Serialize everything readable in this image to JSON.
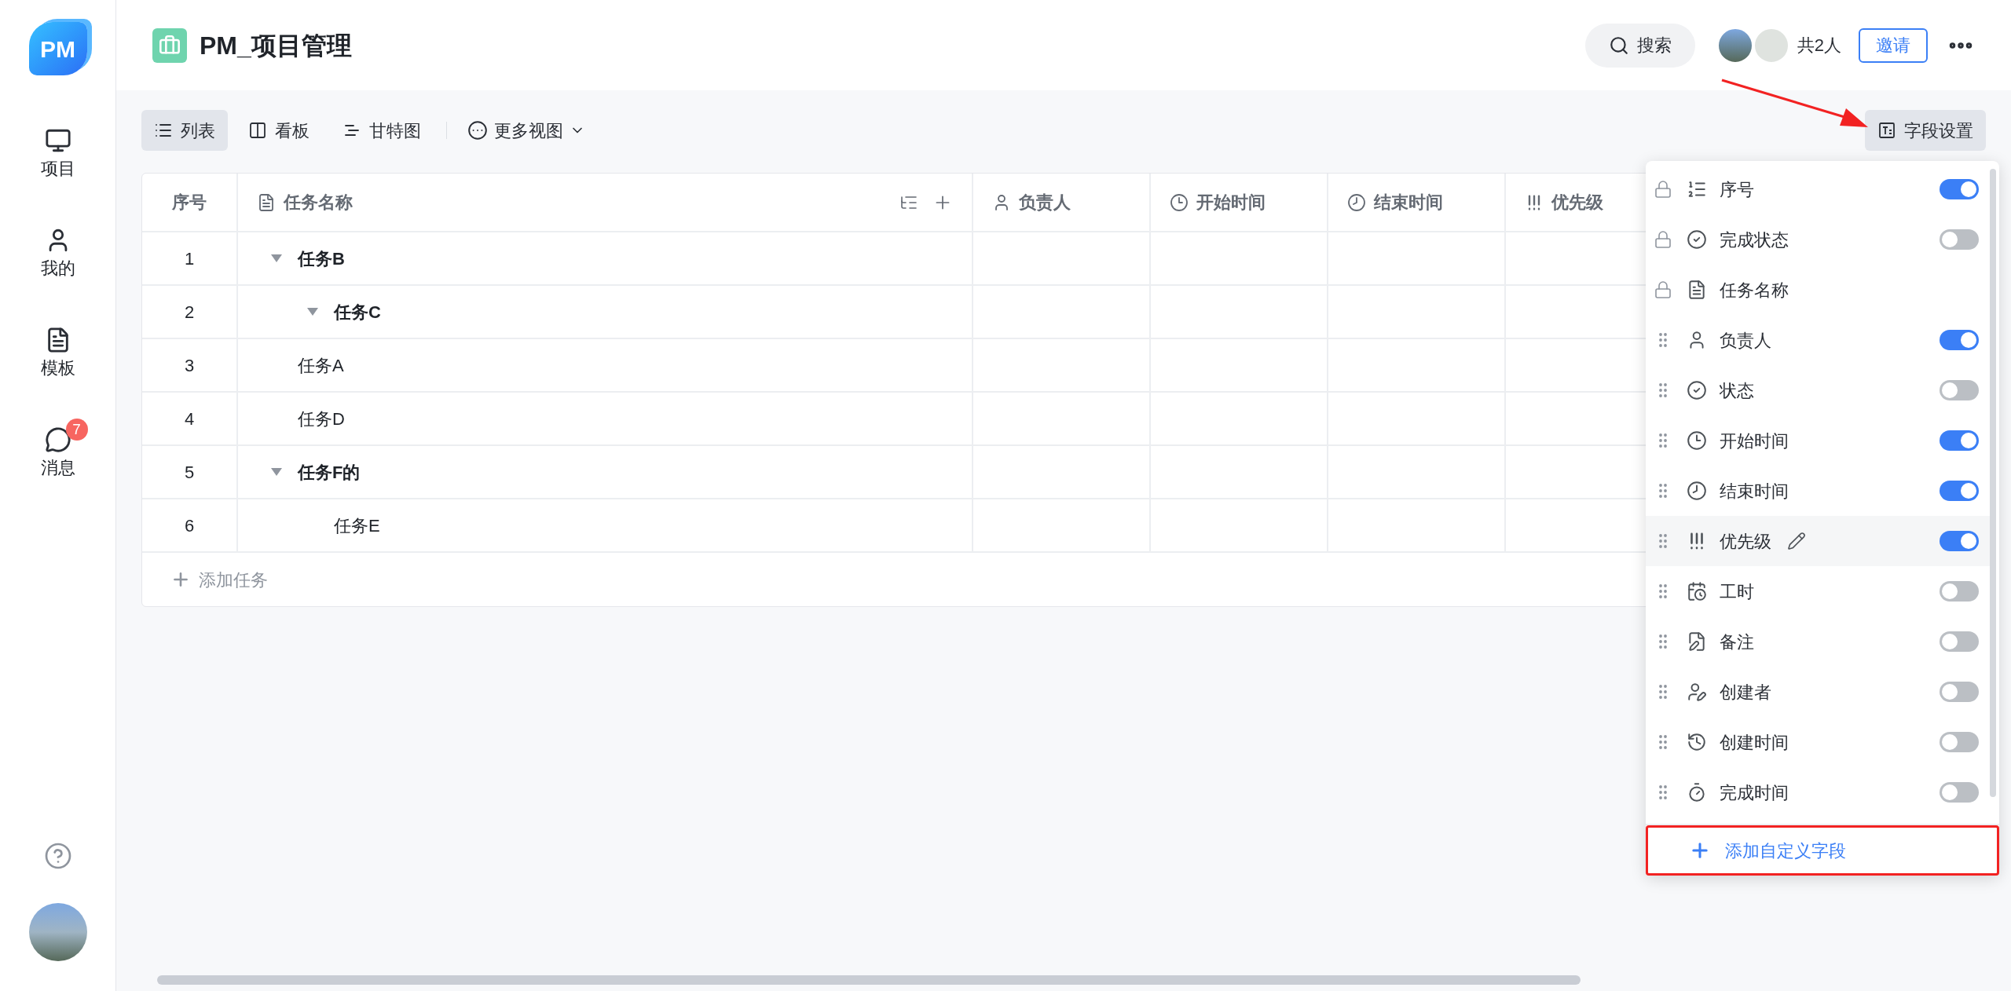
{
  "sidebar": {
    "logo": "PM",
    "items": [
      {
        "label": "项目",
        "kind": "project",
        "selected": false
      },
      {
        "label": "我的",
        "kind": "mine",
        "selected": false
      },
      {
        "label": "模板",
        "kind": "template",
        "selected": false
      },
      {
        "label": "消息",
        "kind": "message",
        "selected": false,
        "badge": "7"
      }
    ]
  },
  "header": {
    "title": "PM_项目管理",
    "search": "搜索",
    "members": "共2人",
    "invite": "邀请"
  },
  "toolbar": {
    "views": [
      {
        "label": "列表",
        "kind": "list",
        "selected": true
      },
      {
        "label": "看板",
        "kind": "board",
        "selected": false
      },
      {
        "label": "甘特图",
        "kind": "gantt",
        "selected": false
      }
    ],
    "more_views": "更多视图",
    "field_settings": "字段设置"
  },
  "table": {
    "columns": [
      {
        "label": "序号",
        "kind": "index"
      },
      {
        "label": "任务名称",
        "kind": "name"
      },
      {
        "label": "负责人",
        "kind": "person"
      },
      {
        "label": "开始时间",
        "kind": "start"
      },
      {
        "label": "结束时间",
        "kind": "end"
      },
      {
        "label": "优先级",
        "kind": "priority"
      }
    ],
    "rows": [
      {
        "index": "1",
        "name": "任务B",
        "expanded": true,
        "children": [
          {
            "index": "2",
            "name": "任务C",
            "expanded": true
          }
        ]
      },
      {
        "index": "3",
        "name": "任务A"
      },
      {
        "index": "4",
        "name": "任务D"
      },
      {
        "index": "5",
        "name": "任务F的",
        "expanded": true,
        "children": [
          {
            "index": "6",
            "name": "任务E"
          }
        ]
      }
    ],
    "add_task": "添加任务"
  },
  "field_panel": {
    "items": [
      {
        "label": "序号",
        "kind": "index",
        "locked": true,
        "on": true,
        "highlighted": false
      },
      {
        "label": "完成状态",
        "kind": "done_status",
        "locked": true,
        "on": false,
        "highlighted": false
      },
      {
        "label": "任务名称",
        "kind": "name",
        "locked": true,
        "highlighted": false
      },
      {
        "label": "负责人",
        "kind": "person",
        "locked": false,
        "on": true,
        "highlighted": false
      },
      {
        "label": "状态",
        "kind": "status",
        "locked": false,
        "on": false,
        "highlighted": false
      },
      {
        "label": "开始时间",
        "kind": "start",
        "locked": false,
        "on": true,
        "highlighted": false
      },
      {
        "label": "结束时间",
        "kind": "end",
        "locked": false,
        "on": true,
        "highlighted": false
      },
      {
        "label": "优先级",
        "kind": "priority",
        "locked": false,
        "on": true,
        "highlighted": true
      },
      {
        "label": "工时",
        "kind": "hours",
        "locked": false,
        "on": false,
        "highlighted": false
      },
      {
        "label": "备注",
        "kind": "note",
        "locked": false,
        "on": false,
        "highlighted": false
      },
      {
        "label": "创建者",
        "kind": "creator",
        "locked": false,
        "on": false,
        "highlighted": false
      },
      {
        "label": "创建时间",
        "kind": "created",
        "locked": false,
        "on": false,
        "highlighted": false
      },
      {
        "label": "完成时间",
        "kind": "completed",
        "locked": false,
        "on": false,
        "highlighted": false
      }
    ],
    "add_field": "添加自定义字段"
  }
}
